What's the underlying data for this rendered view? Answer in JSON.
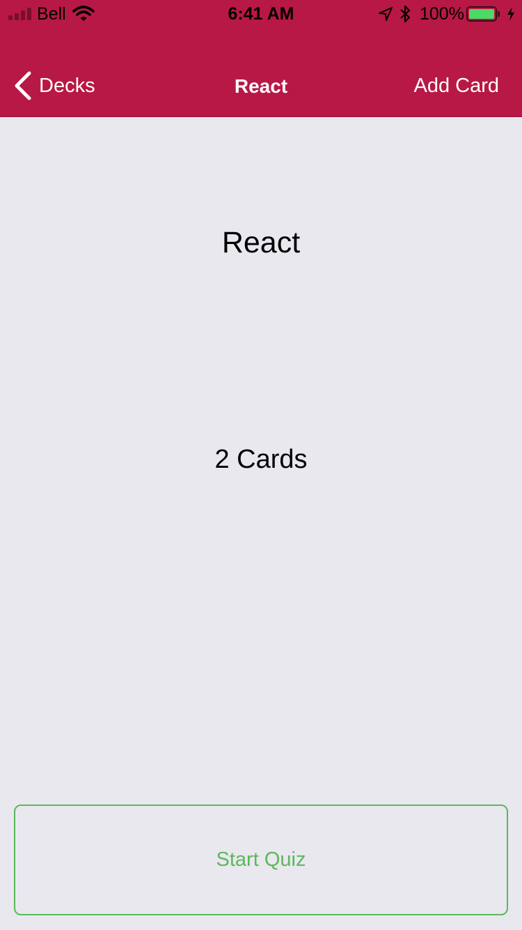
{
  "status_bar": {
    "carrier": "Bell",
    "time": "6:41 AM",
    "battery_percent": "100%",
    "battery_level": 1.0,
    "icons": [
      "signal-icon",
      "wifi-icon",
      "location-icon",
      "bluetooth-icon",
      "battery-icon",
      "charging-icon"
    ]
  },
  "nav": {
    "back_label": "Decks",
    "title": "React",
    "right_action": "Add Card",
    "background_color": "#b81845"
  },
  "deck": {
    "title": "React",
    "card_count": "2 Cards"
  },
  "actions": {
    "start_quiz_label": "Start Quiz",
    "accent_color": "#5cb85c"
  }
}
